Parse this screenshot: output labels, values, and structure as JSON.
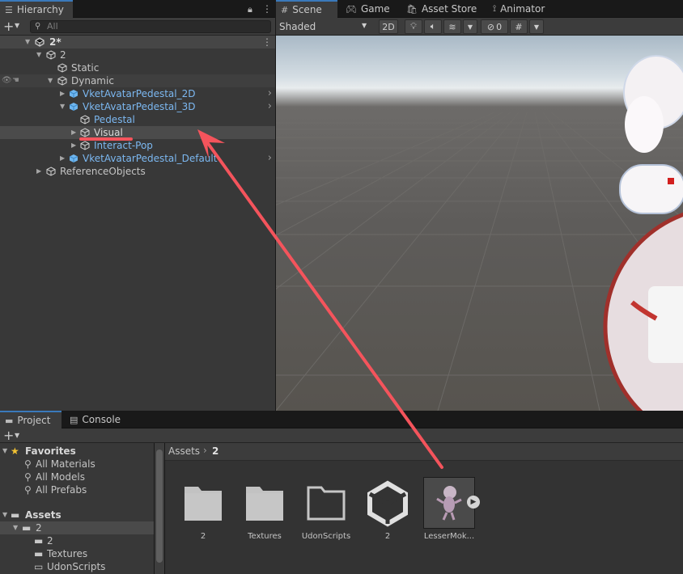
{
  "hierarchy": {
    "tab_label": "Hierarchy",
    "search_placeholder": "All",
    "scene_root": "2*",
    "items": [
      {
        "label": "2"
      },
      {
        "label": "Static"
      },
      {
        "label": "Dynamic"
      },
      {
        "label": "VketAvatarPedestal_2D"
      },
      {
        "label": "VketAvatarPedestal_3D"
      },
      {
        "label": "Pedestal"
      },
      {
        "label": "Visual"
      },
      {
        "label": "Interact-Pop"
      },
      {
        "label": "VketAvatarPedestal_Default"
      },
      {
        "label": "ReferenceObjects"
      }
    ]
  },
  "scene": {
    "tabs": [
      "Scene",
      "Game",
      "Asset Store",
      "Animator"
    ],
    "shading_mode": "Shaded",
    "toggle_2d": "2D",
    "hidden_count": "0"
  },
  "project": {
    "tabs": [
      "Project",
      "Console"
    ],
    "sidebar": {
      "favorites_label": "Favorites",
      "favorites": [
        "All Materials",
        "All Models",
        "All Prefabs"
      ],
      "assets_label": "Assets",
      "folders": [
        {
          "label": "2"
        },
        {
          "label": "2"
        },
        {
          "label": "Textures"
        },
        {
          "label": "UdonScripts"
        }
      ]
    },
    "breadcrumb": [
      "Assets",
      "2"
    ],
    "grid": [
      {
        "label": "2",
        "kind": "folder"
      },
      {
        "label": "Textures",
        "kind": "folder"
      },
      {
        "label": "UdonScripts",
        "kind": "folder-empty"
      },
      {
        "label": "2",
        "kind": "unity-scene"
      },
      {
        "label": "LesserMok...",
        "kind": "prefab"
      }
    ]
  },
  "colors": {
    "annotation": "#f4545c",
    "link_blue": "#7cb8f1",
    "selection": "#2c5d87"
  }
}
